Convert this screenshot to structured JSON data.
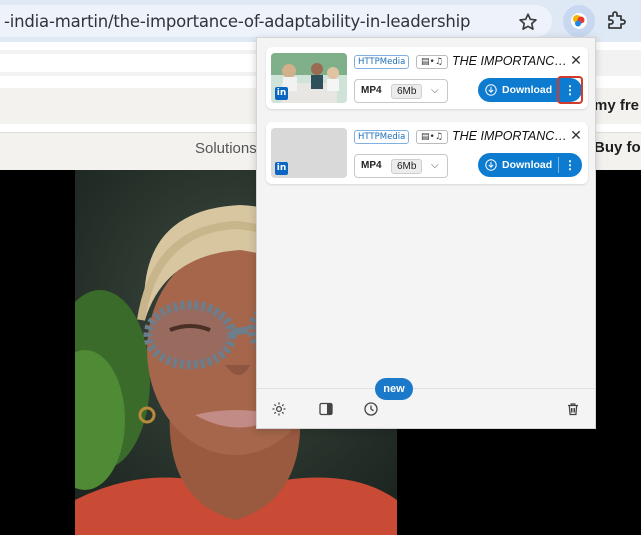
{
  "browser": {
    "url_text": "-india-martin/the-importance-of-adaptability-in-leadership",
    "star_icon": "bookmark-star-icon",
    "extension_icon": "video-downloader-extension-icon",
    "puzzle_icon": "extensions-puzzle-icon"
  },
  "page": {
    "nav_solutions": "Solutions",
    "right_text_top": "my fre",
    "right_text_nav": "Buy fo"
  },
  "popup": {
    "items": [
      {
        "source": "HTTPMedia",
        "title": "THE IMPORTANCE ...",
        "format": "MP4",
        "size": "6Mb",
        "download_label": "Download",
        "has_thumbnail": true
      },
      {
        "source": "HTTPMedia",
        "title": "THE IMPORTANCE ...",
        "format": "MP4",
        "size": "6Mb",
        "download_label": "Download",
        "has_thumbnail": false
      }
    ],
    "footer": {
      "new_badge": "new"
    }
  },
  "colors": {
    "accent": "#0d7bd0",
    "highlight": "#d43a2a",
    "linkedin": "#0a66c2"
  }
}
